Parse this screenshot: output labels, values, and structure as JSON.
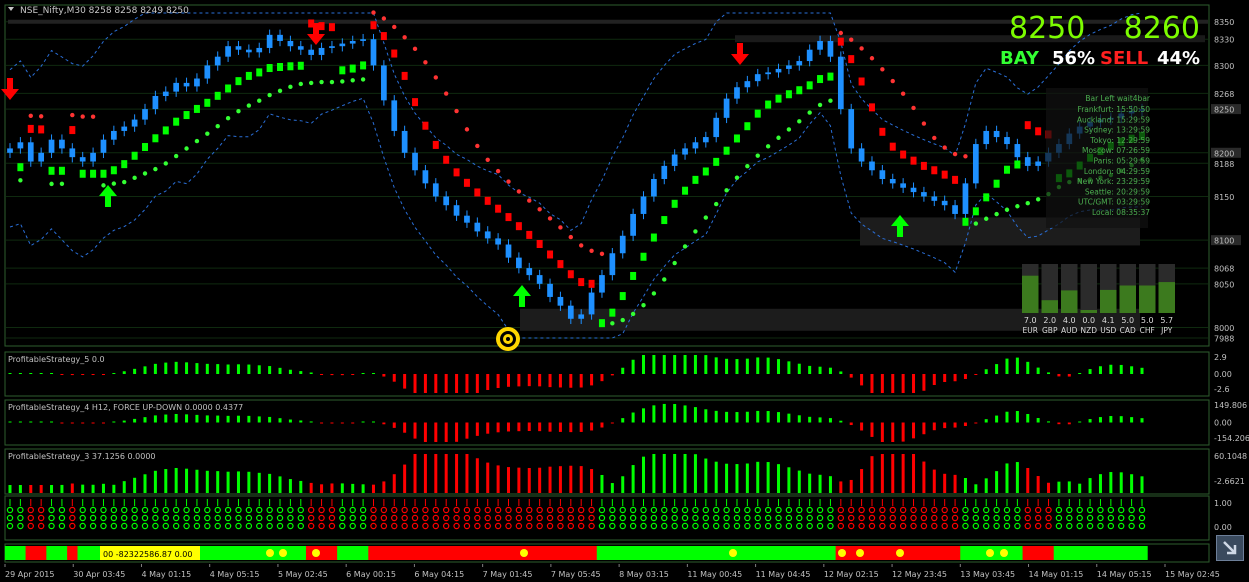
{
  "chart_data": {
    "type": "candlestick",
    "symbol_header": "NSE_Nifty,M30  8258 8258 8249 8250",
    "price_axis": {
      "ticks": [
        7988,
        8000,
        8050,
        8068,
        8100,
        8150,
        8188,
        8200,
        8250,
        8268,
        8300,
        8330,
        8350
      ],
      "ylim": [
        7988,
        8360
      ]
    },
    "quote": {
      "bid": "8250",
      "ask": "8260"
    },
    "sentiment": {
      "buy_label": "BAY",
      "buy_pct": "56%",
      "sell_label": "SELL",
      "sell_pct": "44%"
    },
    "candles": {
      "closes": [
        8205,
        8212,
        8190,
        8200,
        8215,
        8205,
        8195,
        8190,
        8200,
        8215,
        8225,
        8230,
        8238,
        8250,
        8265,
        8270,
        8280,
        8276,
        8285,
        8300,
        8310,
        8322,
        8318,
        8315,
        8320,
        8335,
        8328,
        8322,
        8318,
        8312,
        8320,
        8322,
        8325,
        8328,
        8330,
        8300,
        8260,
        8225,
        8200,
        8180,
        8165,
        8150,
        8140,
        8128,
        8120,
        8110,
        8102,
        8095,
        8080,
        8068,
        8060,
        8050,
        8035,
        8025,
        8010,
        8015,
        8040,
        8060,
        8085,
        8105,
        8130,
        8150,
        8170,
        8185,
        8198,
        8205,
        8212,
        8218,
        8240,
        8262,
        8275,
        8282,
        8290,
        8292,
        8296,
        8300,
        8305,
        8318,
        8328,
        8310,
        8250,
        8205,
        8190,
        8180,
        8170,
        8165,
        8160,
        8155,
        8150,
        8145,
        8140,
        8130,
        8165,
        8210,
        8225,
        8218,
        8210,
        8195,
        8185,
        8190,
        8200,
        8210,
        8222,
        8230,
        8235,
        8238,
        8240,
        8245,
        8248,
        8250
      ]
    },
    "market_sessions": {
      "title": "Bar Left wait4bar",
      "rows": [
        "Frankfurt: 15:50:50",
        "Auckland: 15:29:59",
        "Sydney: 13:29:59",
        "Tokyo: 12:29:59",
        "Moscow: 07:26:59",
        "Paris: 05:29:59",
        "London: 04:29:59",
        "New York: 23:29:59",
        "Seattle: 20:29:59",
        "UTC/GMT: 03:29:59",
        "Local: 08:35:37"
      ]
    },
    "currency_strength": {
      "currencies": [
        "EUR",
        "GBP",
        "AUD",
        "NZD",
        "USD",
        "CAD",
        "CHF",
        "JPY"
      ],
      "values": [
        7.0,
        2.0,
        4.0,
        0.0,
        4.1,
        5.0,
        5.0,
        5.7
      ],
      "labels": [
        "7.0",
        "2.0",
        "4.0",
        "0.0",
        "4.1",
        "5.0",
        "5.0",
        "5.7"
      ]
    },
    "indicators": [
      {
        "name": "ProfitableStrategy_5  0.0",
        "axis": [
          "2.9",
          "0.00",
          "-2.6"
        ]
      },
      {
        "name": "ProfitableStrategy_4  H12, FORCE UP-DOWN  0.0000  0.4377",
        "axis": [
          "149.806",
          "0.00",
          "-154.206"
        ]
      },
      {
        "name": "ProfitableStrategy_3  37.1256  0.0000",
        "axis": [
          "60.1048",
          "-2.6621"
        ]
      },
      {
        "name": "",
        "axis": [
          "1.00",
          "0.00"
        ]
      }
    ],
    "bottom_strip_text": "00  -82322586.87  0.00",
    "time_axis": [
      "29 Apr 2015",
      "30 Apr 03:45",
      "4 May 01:15",
      "4 May 05:15",
      "5 May 02:45",
      "6 May 00:15",
      "6 May 04:15",
      "7 May 01:45",
      "7 May 05:45",
      "8 May 03:15",
      "11 May 00:45",
      "11 May 04:45",
      "12 May 02:15",
      "12 May 23:45",
      "13 May 03:45",
      "14 May 01:15",
      "14 May 05:15",
      "15 May 02:45"
    ],
    "colors": {
      "bull": "#1e90ff",
      "up_trend": "#00ff00",
      "down_trend": "#ff0000",
      "dot_up": "#33ff33",
      "dot_down": "#ff3333",
      "quote": "#7cfc00",
      "grid": "#1d3a1d"
    }
  }
}
